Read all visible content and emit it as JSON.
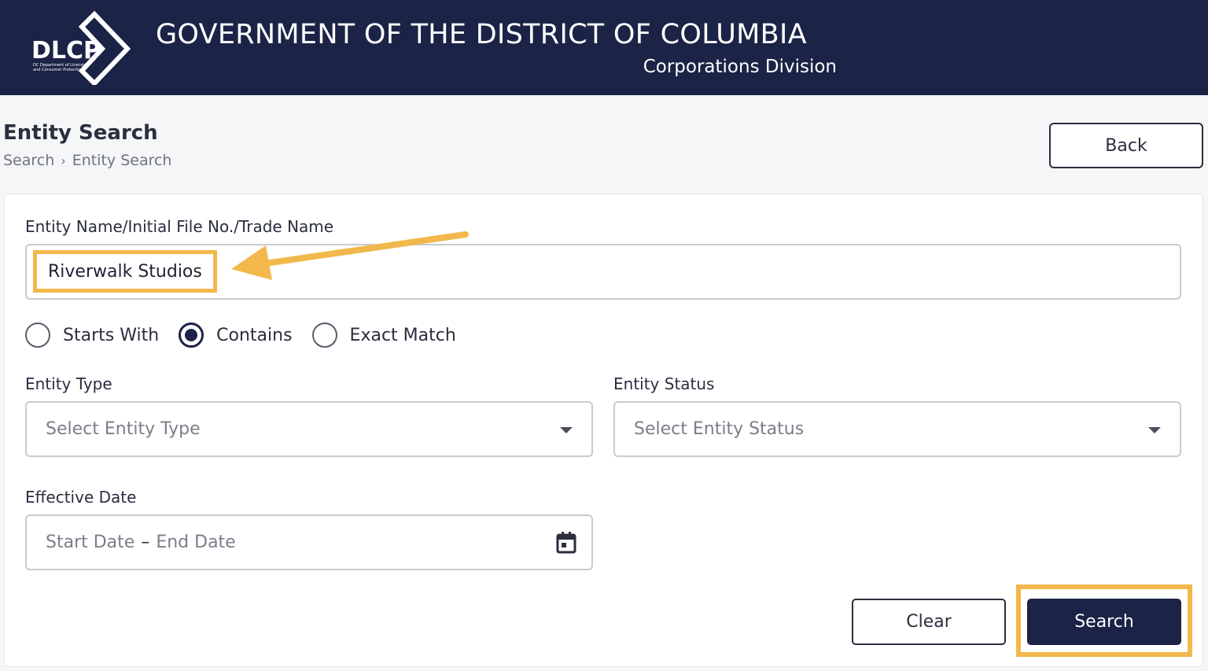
{
  "header": {
    "logo_text": "DLCP",
    "logo_subtext": "DC Department of Licensing and Consumer Protection",
    "title": "GOVERNMENT OF THE DISTRICT OF COLUMBIA",
    "subtitle": "Corporations Division"
  },
  "page": {
    "title": "Entity Search",
    "breadcrumb": [
      "Search",
      "Entity Search"
    ],
    "back_label": "Back"
  },
  "form": {
    "name_label": "Entity Name/Initial File No./Trade Name",
    "name_value": "Riverwalk Studios",
    "match_options": [
      "Starts With",
      "Contains",
      "Exact Match"
    ],
    "match_selected": "Contains",
    "entity_type_label": "Entity Type",
    "entity_type_placeholder": "Select Entity Type",
    "entity_status_label": "Entity Status",
    "entity_status_placeholder": "Select Entity Status",
    "effective_date_label": "Effective Date",
    "start_date_placeholder": "Start Date",
    "date_separator": "–",
    "end_date_placeholder": "End Date",
    "clear_label": "Clear",
    "search_label": "Search"
  },
  "colors": {
    "header_bg": "#1b2346",
    "highlight": "#f2b84b",
    "primary_button": "#1b2346"
  },
  "icons": [
    "dropdown-caret-icon",
    "calendar-icon",
    "annotation-arrow"
  ]
}
